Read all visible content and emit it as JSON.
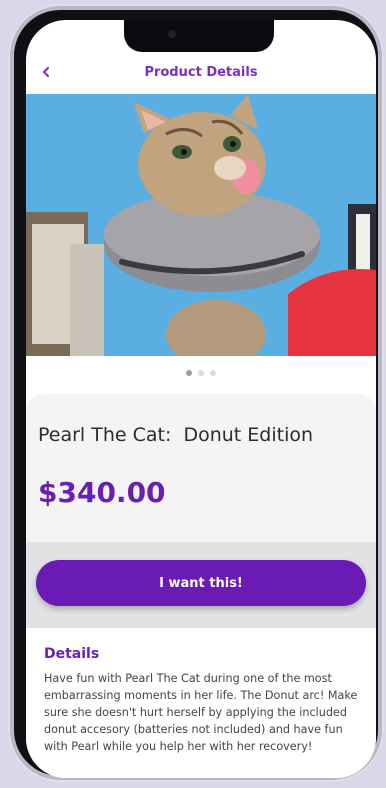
{
  "header": {
    "title": "Product Details",
    "back_icon": "chevron-left-icon"
  },
  "gallery": {
    "page_count": 3,
    "active_index": 0
  },
  "product": {
    "name": "Pearl The Cat:  Donut Edition",
    "price": "$340.00"
  },
  "cta": {
    "label": "I want this!"
  },
  "details": {
    "title": "Details",
    "body": "Have fun with Pearl The Cat during one of the most embarrassing moments in her life. The Donut arc! Make sure she doesn't hurt herself by applying the included donut accesory (batteries not included) and have fun with Pearl while you help her with her recovery!"
  },
  "colors": {
    "accent": "#6a1bb6",
    "title": "#7a2fc0",
    "page_bg": "#d9d7ea"
  }
}
